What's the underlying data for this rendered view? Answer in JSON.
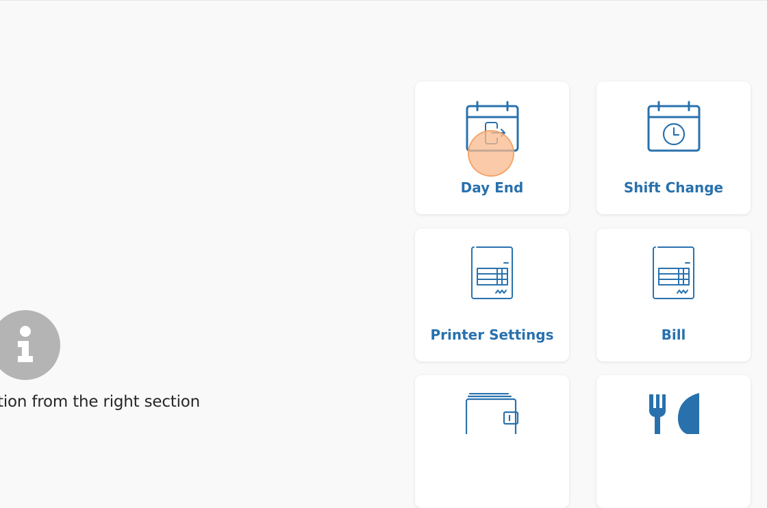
{
  "hint": {
    "text": "tion from the right section"
  },
  "tiles": [
    {
      "label": "Day End",
      "icon": "calendar-exit-icon"
    },
    {
      "label": "Shift Change",
      "icon": "calendar-clock-icon"
    },
    {
      "label": "Printer Settings",
      "icon": "receipt-icon"
    },
    {
      "label": "Bill",
      "icon": "receipt-icon"
    },
    {
      "label": "",
      "icon": "wallet-icon"
    },
    {
      "label": "",
      "icon": "fork-knife-icon"
    }
  ],
  "colors": {
    "accent": "#2871ad",
    "background": "#f9f9f9",
    "info_circle": "#b4b4b4",
    "click_marker": "#fab98c"
  }
}
